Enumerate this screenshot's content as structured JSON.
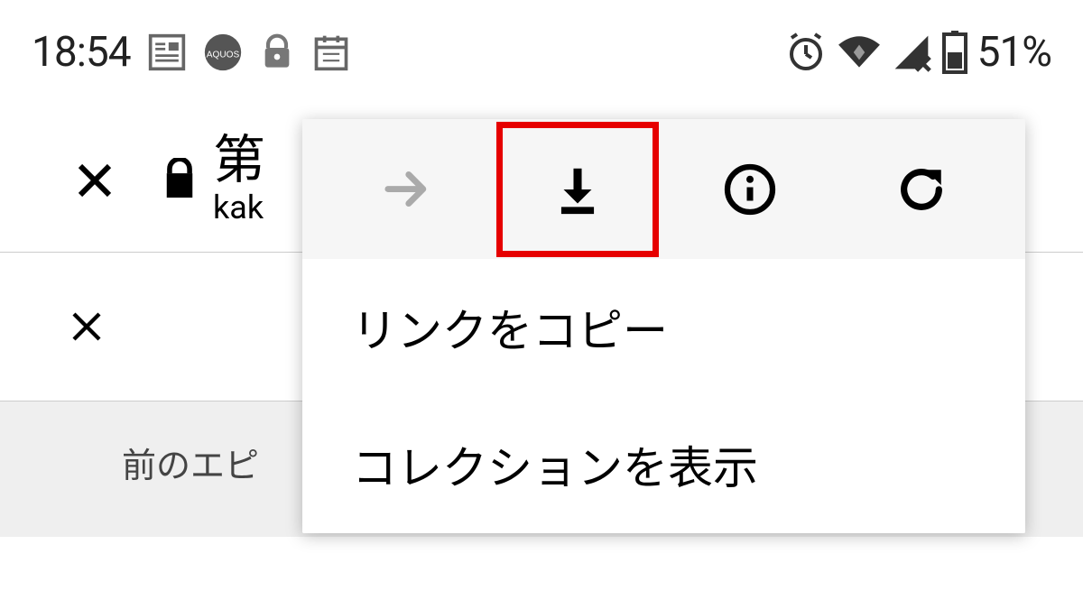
{
  "status_bar": {
    "time": "18:54",
    "battery_text": "51%"
  },
  "app_bar": {
    "title_main": "第",
    "title_sub": "kak"
  },
  "prev_episode_label": "前のエピ",
  "dropdown": {
    "menu_copy_link": "リンクをコピー",
    "menu_view_collection": "コレクションを表示"
  }
}
